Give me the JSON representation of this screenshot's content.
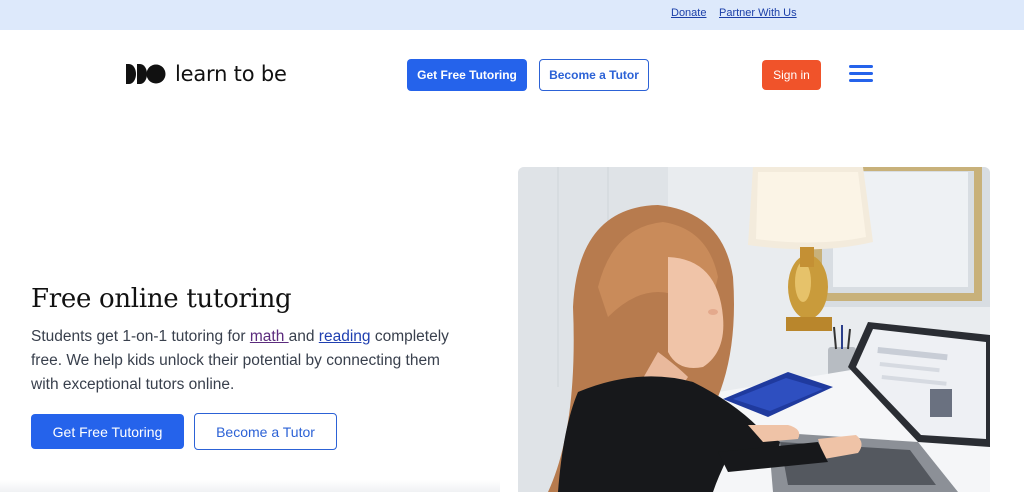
{
  "topbar": {
    "donate": "Donate",
    "partner": "Partner With Us"
  },
  "header": {
    "logo_text": "learn to be",
    "get_tutoring": "Get Free Tutoring",
    "become_tutor": "Become a Tutor",
    "sign_in": "Sign in",
    "menu_icon": "hamburger-icon"
  },
  "hero": {
    "title": "Free online tutoring",
    "text_part1": "Students get 1-on-1 tutoring for ",
    "link_math": "math ",
    "text_part2": "and ",
    "link_reading": "reading",
    "text_part3": " completely free. We help kids unlock their potential by connecting them with exceptional tutors online.",
    "cta_primary": "Get Free Tutoring",
    "cta_secondary": "Become a Tutor"
  },
  "colors": {
    "primary": "#2563eb",
    "signin": "#f0532a",
    "topbar_bg": "#dde9fb"
  }
}
